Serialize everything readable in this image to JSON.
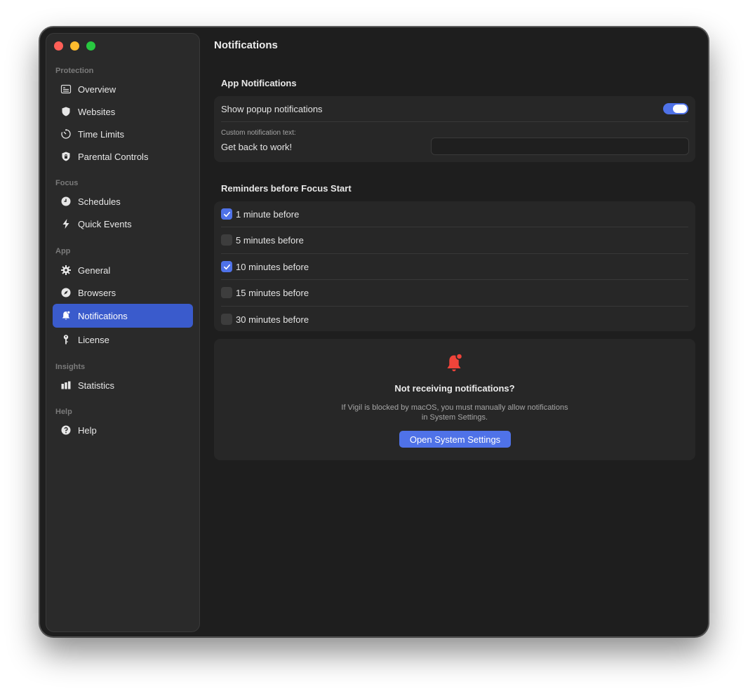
{
  "window": {
    "title": "Notifications"
  },
  "sidebar": {
    "sections": [
      {
        "label": "Protection",
        "items": [
          {
            "label": "Overview",
            "icon": "overview-icon"
          },
          {
            "label": "Websites",
            "icon": "shield-icon"
          },
          {
            "label": "Time Limits",
            "icon": "timer-icon"
          },
          {
            "label": "Parental Controls",
            "icon": "shield-lock-icon"
          }
        ]
      },
      {
        "label": "Focus",
        "items": [
          {
            "label": "Schedules",
            "icon": "clock-icon"
          },
          {
            "label": "Quick Events",
            "icon": "bolt-icon"
          }
        ]
      },
      {
        "label": "App",
        "items": [
          {
            "label": "General",
            "icon": "gear-icon"
          },
          {
            "label": "Browsers",
            "icon": "compass-icon"
          },
          {
            "label": "Notifications",
            "icon": "bell-icon",
            "active": true
          },
          {
            "label": "License",
            "icon": "key-icon"
          }
        ]
      },
      {
        "label": "Insights",
        "items": [
          {
            "label": "Statistics",
            "icon": "bar-chart-icon"
          }
        ]
      },
      {
        "label": "Help",
        "items": [
          {
            "label": "Help",
            "icon": "question-icon"
          }
        ]
      }
    ]
  },
  "app_notifications": {
    "title": "App Notifications",
    "show_popup_label": "Show popup notifications",
    "show_popup_enabled": true,
    "custom_text_label": "Custom notification text:",
    "custom_text_value": "Get back to work!",
    "custom_text_input": ""
  },
  "reminders": {
    "title": "Reminders before Focus Start",
    "items": [
      {
        "label": "1 minute before",
        "checked": true
      },
      {
        "label": "5 minutes before",
        "checked": false
      },
      {
        "label": "10 minutes before",
        "checked": true
      },
      {
        "label": "15 minutes before",
        "checked": false
      },
      {
        "label": "30 minutes before",
        "checked": false
      }
    ]
  },
  "help_card": {
    "title": "Not receiving notifications?",
    "desc_line1": "If Vigil is blocked by macOS, you must manually allow notifications",
    "desc_line2": "in System Settings.",
    "button_label": "Open System Settings"
  },
  "colors": {
    "accent": "#4f72e8",
    "active_nav": "#3a5bcc",
    "bell_red": "#f0443a"
  }
}
